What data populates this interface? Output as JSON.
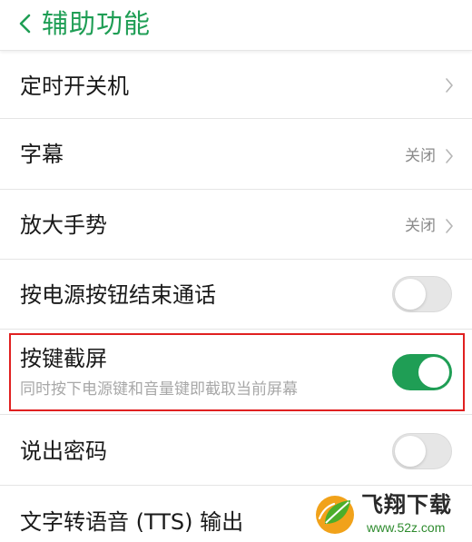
{
  "header": {
    "title": "辅助功能",
    "back_icon": "chevron-left-icon"
  },
  "settings": {
    "scheduled_power": {
      "label": "定时开关机"
    },
    "subtitles": {
      "label": "字幕",
      "value": "关闭"
    },
    "magnification": {
      "label": "放大手势",
      "value": "关闭"
    },
    "power_ends_call": {
      "label": "按电源按钮结束通话",
      "enabled": false
    },
    "key_screenshot": {
      "label": "按键截屏",
      "description": "同时按下电源键和音量键即截取当前屏幕",
      "enabled": true
    },
    "speak_passwords": {
      "label": "说出密码",
      "enabled": false
    },
    "tts_output": {
      "label": "文字转语音 (TTS) 输出"
    }
  },
  "watermark": {
    "name": "飞翔下载",
    "url": "www.52z.com"
  },
  "colors": {
    "accent": "#1f9e55",
    "toggle_off": "#e6e6e6",
    "highlight_border": "#e02020",
    "secondary_text": "#a8a8a8"
  }
}
